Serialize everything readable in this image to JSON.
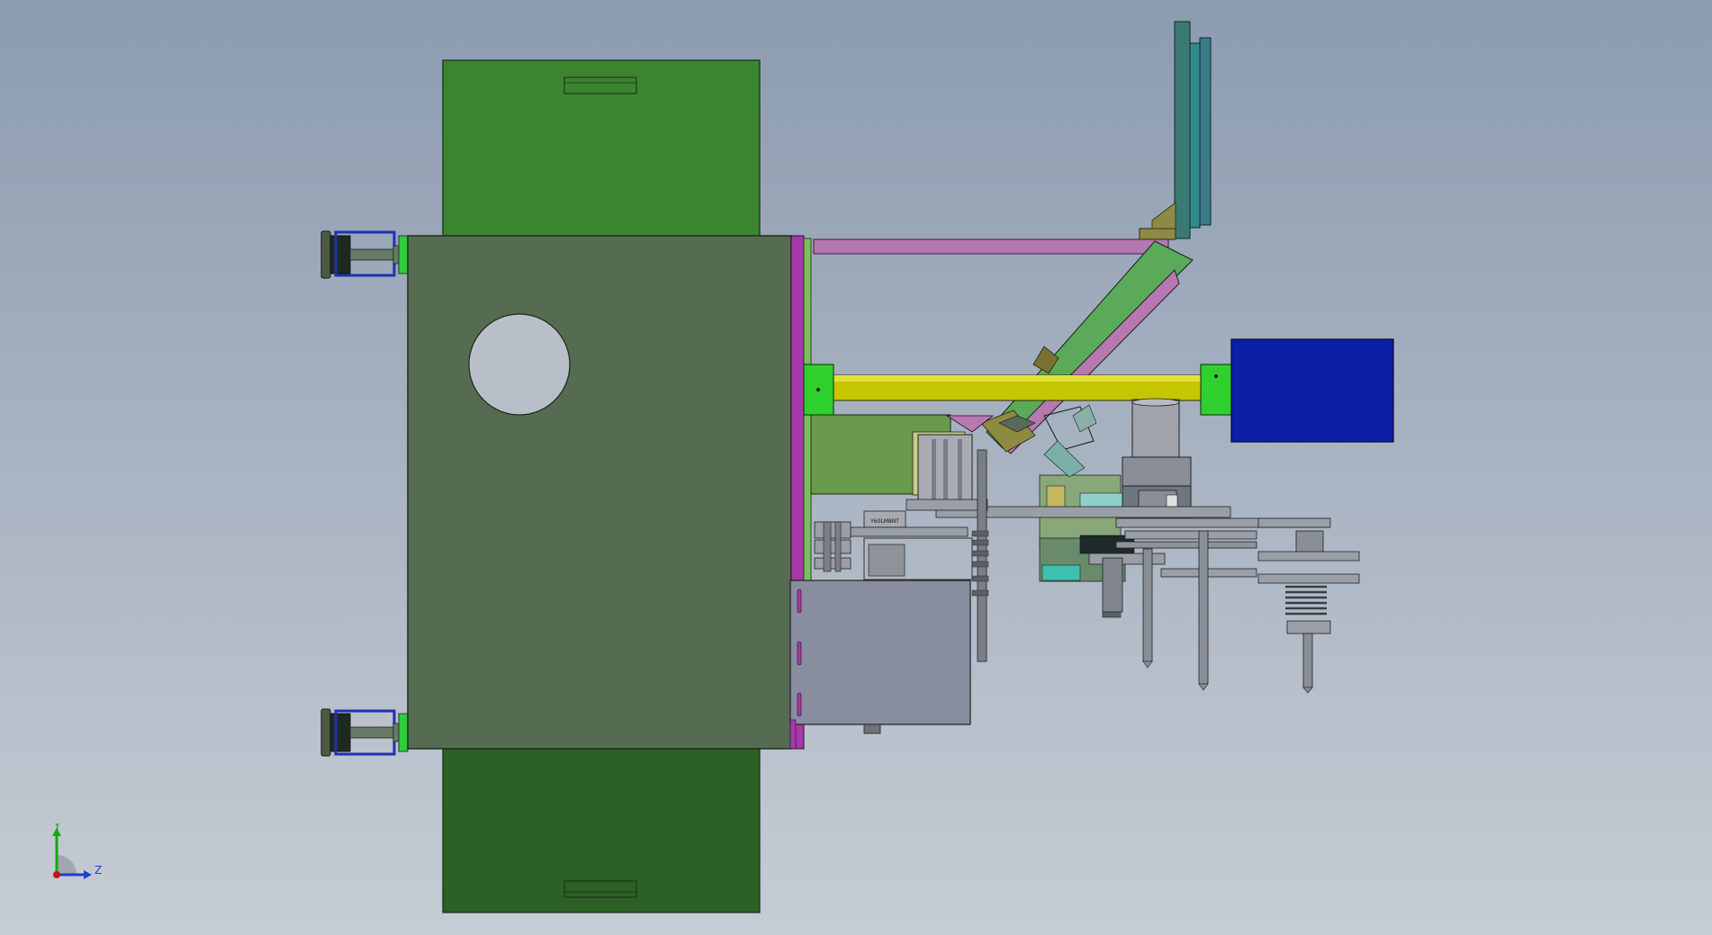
{
  "viewport": {
    "background_top": "#8c9bb0",
    "background_bottom": "#c6ccd4"
  },
  "triad": {
    "y_label": "Y",
    "z_label": "Z",
    "y_color": "#12a812",
    "z_color": "#1e3fd0",
    "origin_color": "#c01818"
  },
  "part_label": "Y60LM8NT",
  "colors": {
    "cabinet_front": "#556b52",
    "door_top": "#3a852e",
    "door_bottom": "#2b6124",
    "purple_frame": "#b03cb0",
    "yellow_rod": "#c8c800",
    "rod_end_green": "#30d030",
    "motor_blue": "#0a1ea8",
    "teal_plate": "#2e7b78",
    "gray_metal": "#8a8e98"
  }
}
